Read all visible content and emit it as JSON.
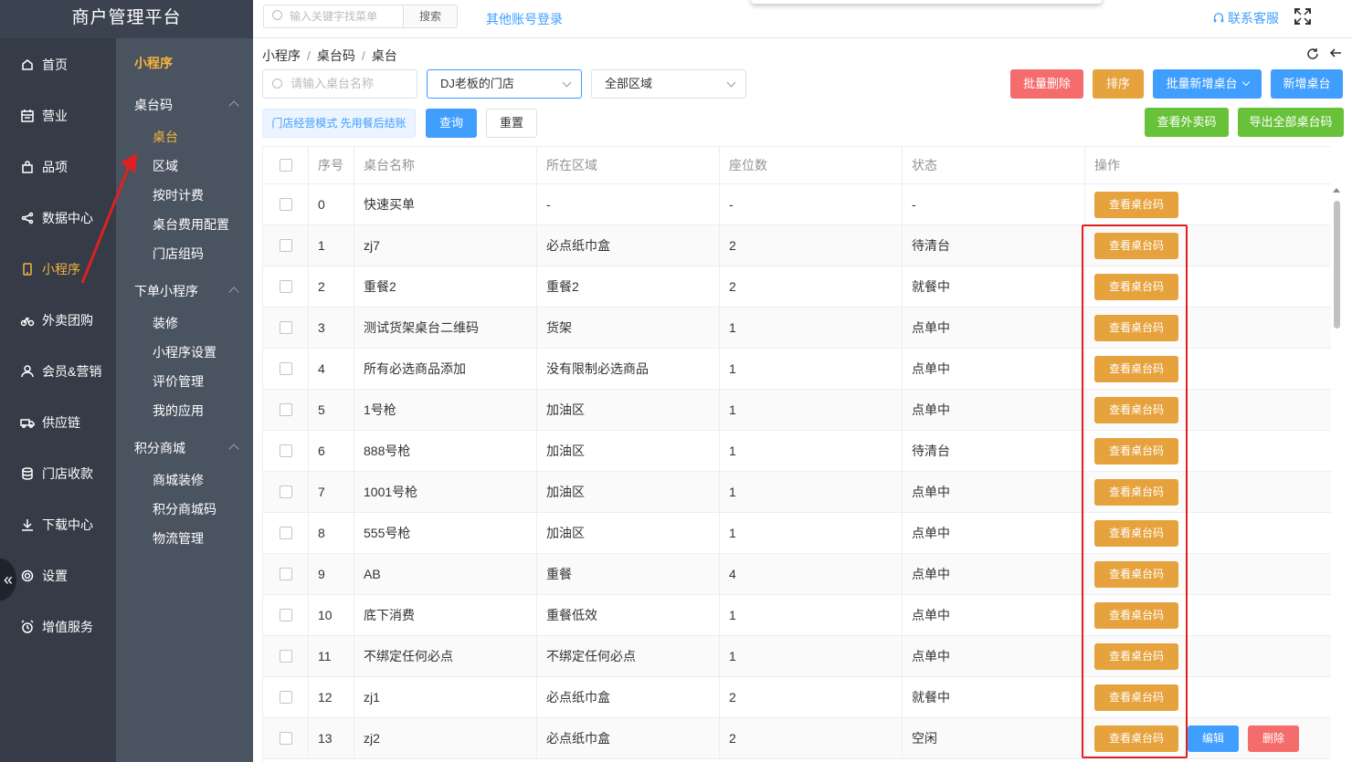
{
  "brand": "商户管理平台",
  "nav": [
    {
      "label": "首页",
      "icon": "home-icon",
      "active": false
    },
    {
      "label": "营业",
      "icon": "calendar-icon",
      "active": false
    },
    {
      "label": "品项",
      "icon": "bag-icon",
      "active": false
    },
    {
      "label": "数据中心",
      "icon": "share-icon",
      "active": false
    },
    {
      "label": "小程序",
      "icon": "mobile-icon",
      "active": true
    },
    {
      "label": "外卖团购",
      "icon": "bike-icon",
      "active": false
    },
    {
      "label": "会员&营销",
      "icon": "user-icon",
      "active": false
    },
    {
      "label": "供应链",
      "icon": "truck-icon",
      "active": false
    },
    {
      "label": "门店收款",
      "icon": "coins-icon",
      "active": false
    },
    {
      "label": "下载中心",
      "icon": "download-icon",
      "active": false
    },
    {
      "label": "设置",
      "icon": "gear-icon",
      "active": false
    },
    {
      "label": "增值服务",
      "icon": "alarm-icon",
      "active": false
    }
  ],
  "subnav": {
    "title": "小程序",
    "groups": [
      {
        "label": "桌台码",
        "items": [
          "桌台",
          "区域",
          "按时计费",
          "桌台费用配置",
          "门店组码"
        ]
      },
      {
        "label": "下单小程序",
        "items": [
          "装修",
          "小程序设置",
          "评价管理",
          "我的应用"
        ]
      },
      {
        "label": "积分商城",
        "items": [
          "商城装修",
          "积分商城码",
          "物流管理"
        ]
      }
    ],
    "active_item": "桌台"
  },
  "topbar": {
    "search_placeholder": "输入关键字找菜单",
    "search_button": "搜索",
    "other_login": "其他账号登录",
    "support": "联系客服"
  },
  "breadcrumb": [
    "小程序",
    "桌台码",
    "桌台"
  ],
  "filters": {
    "name_placeholder": "请输入桌台名称",
    "store": "DJ老板的门店",
    "area": "全部区域",
    "mode_tag": "门店经营模式 先用餐后结账",
    "query": "查询",
    "reset": "重置"
  },
  "actions": {
    "batch_delete": "批量删除",
    "sort": "排序",
    "batch_add": "批量新增桌台",
    "add": "新增桌台",
    "view_takeout": "查看外卖码",
    "export_all": "导出全部桌台码"
  },
  "table": {
    "headers": [
      "序号",
      "桌台名称",
      "所在区域",
      "座位数",
      "状态",
      "操作"
    ],
    "view_label": "查看桌台码",
    "edit_label": "编辑",
    "delete_label": "删除",
    "rows": [
      {
        "no": "0",
        "name": "快速买单",
        "area": "-",
        "seats": "-",
        "status": "-",
        "extra": false
      },
      {
        "no": "1",
        "name": "zj7",
        "area": "必点纸巾盒",
        "seats": "2",
        "status": "待清台",
        "extra": false
      },
      {
        "no": "2",
        "name": "重餐2",
        "area": "重餐2",
        "seats": "2",
        "status": "就餐中",
        "extra": false
      },
      {
        "no": "3",
        "name": "测试货架桌台二维码",
        "area": "货架",
        "seats": "1",
        "status": "点单中",
        "extra": false
      },
      {
        "no": "4",
        "name": "所有必选商品添加",
        "area": "没有限制必选商品",
        "seats": "1",
        "status": "点单中",
        "extra": false
      },
      {
        "no": "5",
        "name": "1号枪",
        "area": "加油区",
        "seats": "1",
        "status": "点单中",
        "extra": false
      },
      {
        "no": "6",
        "name": "888号枪",
        "area": "加油区",
        "seats": "1",
        "status": "待清台",
        "extra": false
      },
      {
        "no": "7",
        "name": "1001号枪",
        "area": "加油区",
        "seats": "1",
        "status": "点单中",
        "extra": false
      },
      {
        "no": "8",
        "name": "555号枪",
        "area": "加油区",
        "seats": "1",
        "status": "点单中",
        "extra": false
      },
      {
        "no": "9",
        "name": "AB",
        "area": "重餐",
        "seats": "4",
        "status": "点单中",
        "extra": false
      },
      {
        "no": "10",
        "name": "底下消费",
        "area": "重餐低效",
        "seats": "1",
        "status": "点单中",
        "extra": false
      },
      {
        "no": "11",
        "name": "不绑定任何必点",
        "area": "不绑定任何必点",
        "seats": "1",
        "status": "点单中",
        "extra": false
      },
      {
        "no": "12",
        "name": "zj1",
        "area": "必点纸巾盒",
        "seats": "2",
        "status": "就餐中",
        "extra": false
      },
      {
        "no": "13",
        "name": "zj2",
        "area": "必点纸巾盒",
        "seats": "2",
        "status": "空闲",
        "extra": true
      }
    ]
  },
  "colors": {
    "accent": "#f5b43c",
    "primary": "#409eff",
    "warning": "#e6a23c",
    "danger": "#f56c6c",
    "success": "#67c23a",
    "annotation": "#e02020"
  }
}
